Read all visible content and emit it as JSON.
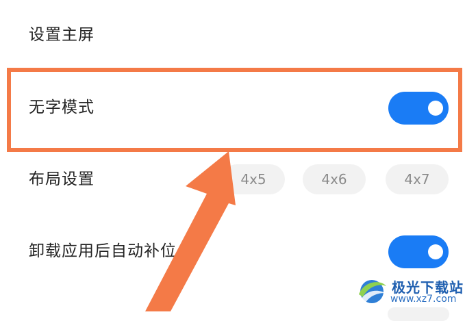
{
  "settings": {
    "set_home": {
      "label": "设置主屏"
    },
    "no_text_mode": {
      "label": "无字模式",
      "enabled": true
    },
    "layout": {
      "label": "布局设置",
      "options": [
        "4x5",
        "4x6",
        "4x7"
      ]
    },
    "auto_restore": {
      "label": "卸载应用后自动补位",
      "enabled": true
    }
  },
  "watermark": {
    "title": "极光下载站",
    "url": "www.xz7.com"
  },
  "colors": {
    "toggle_on": "#1a7cf5",
    "highlight": "#f47a47",
    "chip_bg": "#f2f2f2"
  }
}
